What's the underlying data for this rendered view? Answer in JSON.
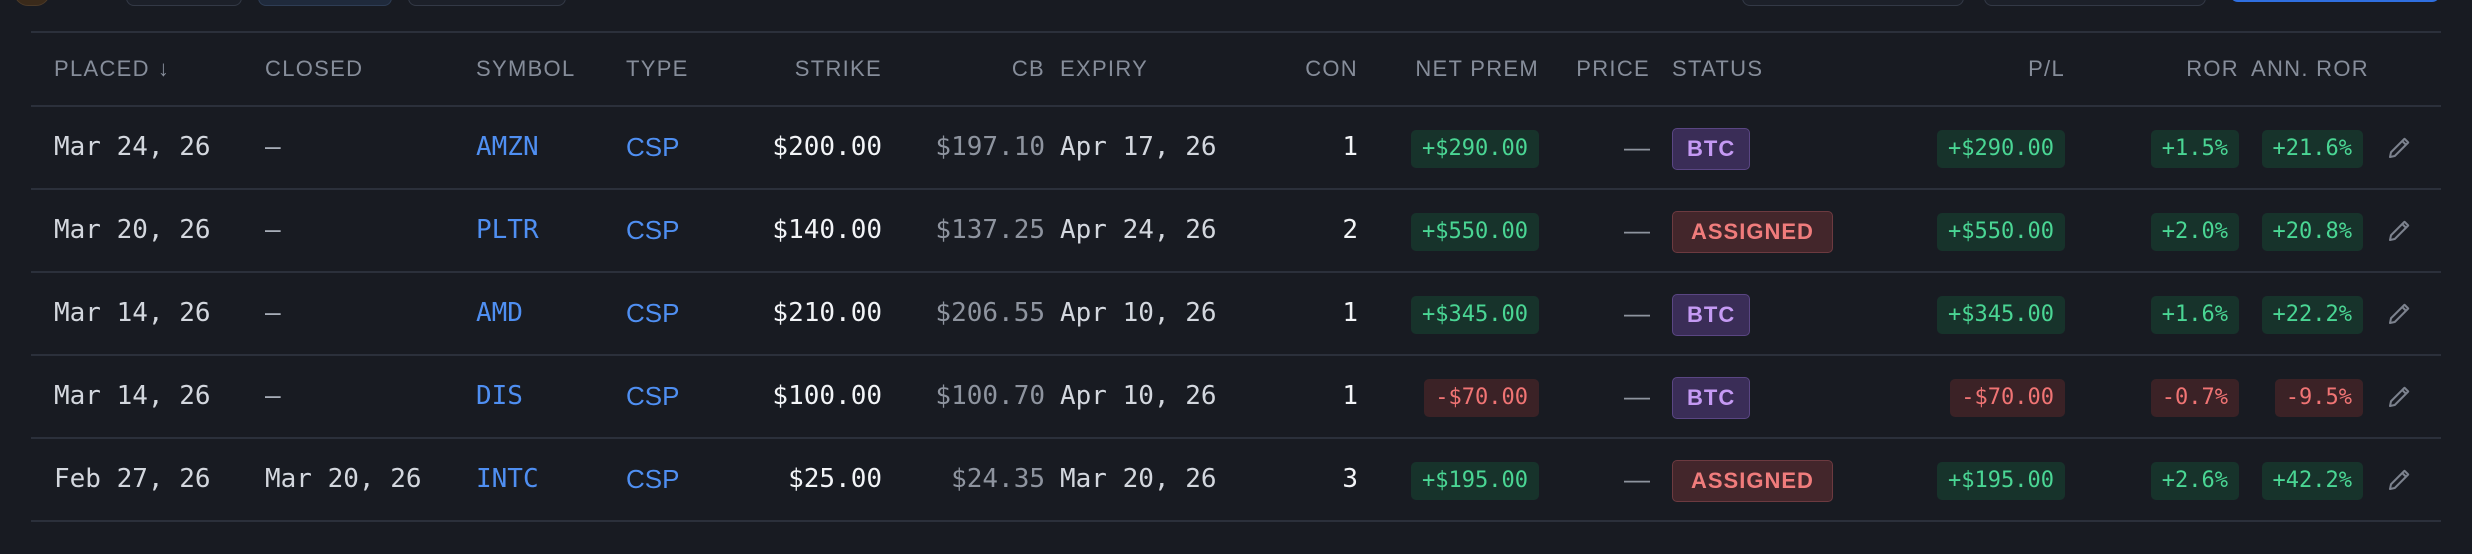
{
  "columns": {
    "placed": "PLACED",
    "closed": "CLOSED",
    "symbol": "SYMBOL",
    "type": "TYPE",
    "strike": "STRIKE",
    "cb": "CB",
    "expiry": "EXPIRY",
    "con": "CON",
    "net_prem": "NET PREM",
    "price": "PRICE",
    "status": "STATUS",
    "pl": "P/L",
    "ror": "ROR",
    "ann_ror": "ANN. ROR"
  },
  "sort_icon": "arrow-down-icon",
  "colors": {
    "background": "#181b22",
    "positive": "#4ad694",
    "negative": "#f07474",
    "link": "#4f8ff2",
    "btc": "#c59af4",
    "assigned": "#f07c7c"
  },
  "rows": [
    {
      "placed": "Mar 24, 26",
      "closed": "—",
      "symbol": "AMZN",
      "type": "CSP",
      "strike": "$200.00",
      "cb": "$197.10",
      "expiry": "Apr 17, 26",
      "con": "1",
      "net_prem": "+$290.00",
      "price": "—",
      "status": "BTC",
      "pl": "+$290.00",
      "ror": "+1.5%",
      "ann_ror": "+21.6%",
      "sign": "pos",
      "status_kind": "btc"
    },
    {
      "placed": "Mar 20, 26",
      "closed": "—",
      "symbol": "PLTR",
      "type": "CSP",
      "strike": "$140.00",
      "cb": "$137.25",
      "expiry": "Apr 24, 26",
      "con": "2",
      "net_prem": "+$550.00",
      "price": "—",
      "status": "ASSIGNED",
      "pl": "+$550.00",
      "ror": "+2.0%",
      "ann_ror": "+20.8%",
      "sign": "pos",
      "status_kind": "assigned"
    },
    {
      "placed": "Mar 14, 26",
      "closed": "—",
      "symbol": "AMD",
      "type": "CSP",
      "strike": "$210.00",
      "cb": "$206.55",
      "expiry": "Apr 10, 26",
      "con": "1",
      "net_prem": "+$345.00",
      "price": "—",
      "status": "BTC",
      "pl": "+$345.00",
      "ror": "+1.6%",
      "ann_ror": "+22.2%",
      "sign": "pos",
      "status_kind": "btc"
    },
    {
      "placed": "Mar 14, 26",
      "closed": "—",
      "symbol": "DIS",
      "type": "CSP",
      "strike": "$100.00",
      "cb": "$100.70",
      "expiry": "Apr 10, 26",
      "con": "1",
      "net_prem": "-$70.00",
      "price": "—",
      "status": "BTC",
      "pl": "-$70.00",
      "ror": "-0.7%",
      "ann_ror": "-9.5%",
      "sign": "neg",
      "status_kind": "btc"
    },
    {
      "placed": "Feb 27, 26",
      "closed": "Mar 20, 26",
      "symbol": "INTC",
      "type": "CSP",
      "strike": "$25.00",
      "cb": "$24.35",
      "expiry": "Mar 20, 26",
      "con": "3",
      "net_prem": "+$195.00",
      "price": "—",
      "status": "ASSIGNED",
      "pl": "+$195.00",
      "ror": "+2.6%",
      "ann_ror": "+42.2%",
      "sign": "pos",
      "status_kind": "assigned"
    }
  ],
  "row_action_icon": "pencil-icon"
}
